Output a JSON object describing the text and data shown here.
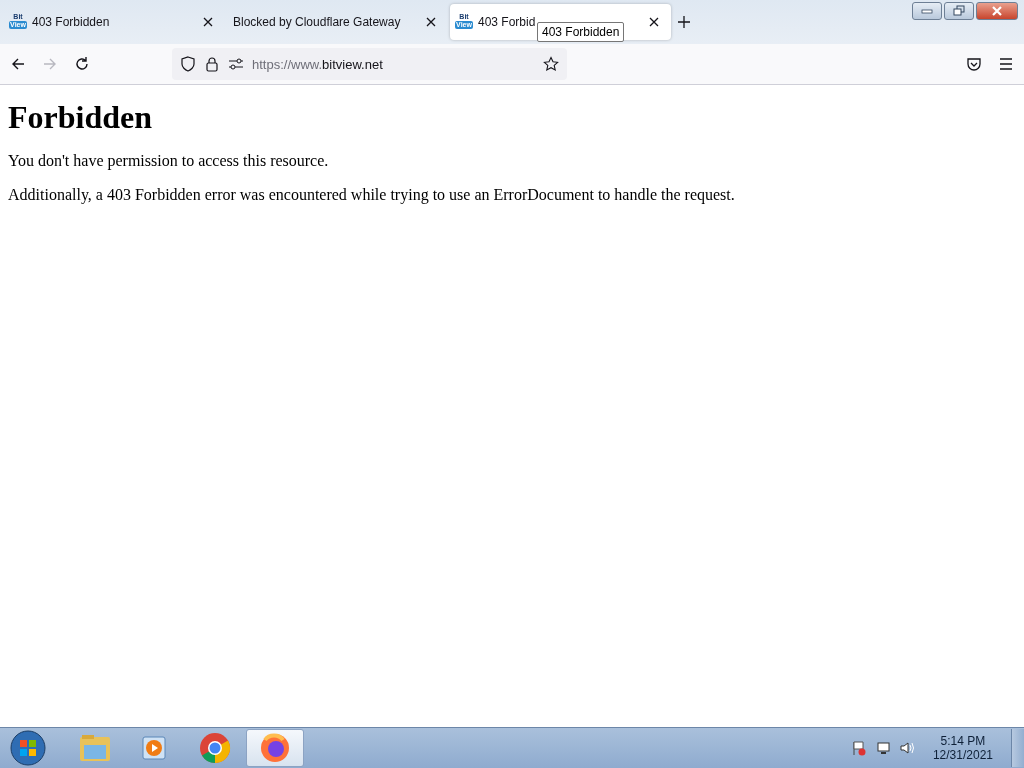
{
  "tabs": [
    {
      "title": "403 Forbidden",
      "favicon": [
        "Bit",
        "View"
      ],
      "selected": false
    },
    {
      "title": "Blocked by Cloudflare Gateway",
      "selected": false
    },
    {
      "title": "403 Forbid",
      "favicon": [
        "Bit",
        "View"
      ],
      "selected": true
    }
  ],
  "tooltip": "403 Forbidden",
  "url": {
    "prefix": "https://www.",
    "domain": "bitview.net"
  },
  "nav": {
    "forward_disabled": true
  },
  "page": {
    "heading": "Forbidden",
    "paragraphs": [
      "You don't have permission to access this resource.",
      "Additionally, a 403 Forbidden error was encountered while trying to use an ErrorDocument to handle the request."
    ]
  },
  "taskbar": {
    "apps": [
      {
        "kind": "explorer",
        "selected": false
      },
      {
        "kind": "media",
        "selected": false
      },
      {
        "kind": "chrome",
        "selected": false
      },
      {
        "kind": "firefox",
        "selected": true
      }
    ],
    "time": "5:14 PM",
    "date": "12/31/2021"
  }
}
